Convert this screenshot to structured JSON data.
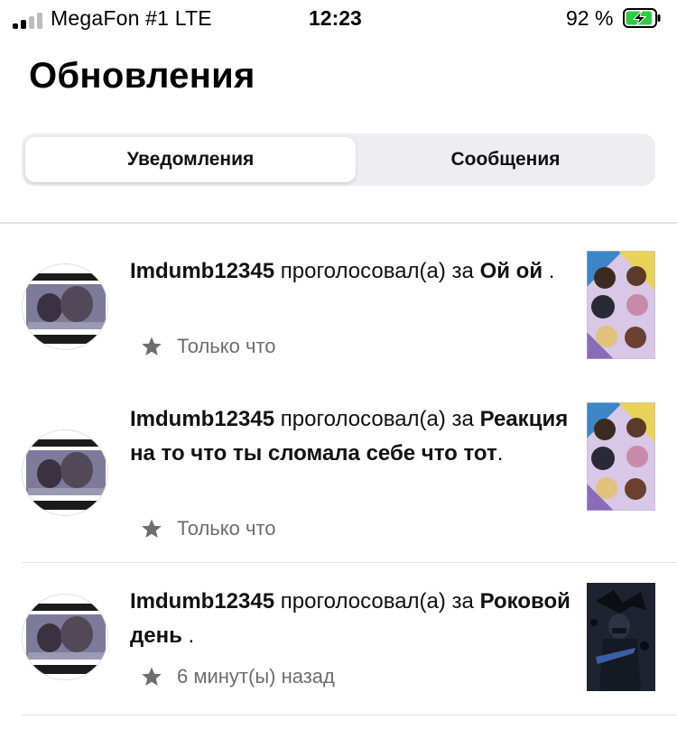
{
  "status_bar": {
    "carrier": "MegaFon #1  LTE",
    "time": "12:23",
    "battery_percent": "92 %",
    "battery_level": 0.92,
    "battery_color": "#2ecc40"
  },
  "page": {
    "title": "Обновления"
  },
  "tabs": [
    {
      "label": "Уведомления",
      "active": true
    },
    {
      "label": "Сообщения",
      "active": false
    }
  ],
  "notifications": [
    {
      "user": "Imdumb12345",
      "action": " проголосовал(а) за ",
      "story_title": "Ой ой",
      "suffix": " .",
      "time": "Только что",
      "icon": "star-icon"
    },
    {
      "user": "Imdumb12345",
      "action": " проголосовал(а) за ",
      "story_title": "Реакция на то что ты сломала себе что тот",
      "suffix": ".",
      "time": "Только что",
      "icon": "star-icon"
    },
    {
      "user": "Imdumb12345",
      "action": " проголосовал(а) за ",
      "story_title": "Роковой день",
      "suffix": " .",
      "time": "6 минут(ы) назад",
      "icon": "star-icon"
    }
  ]
}
